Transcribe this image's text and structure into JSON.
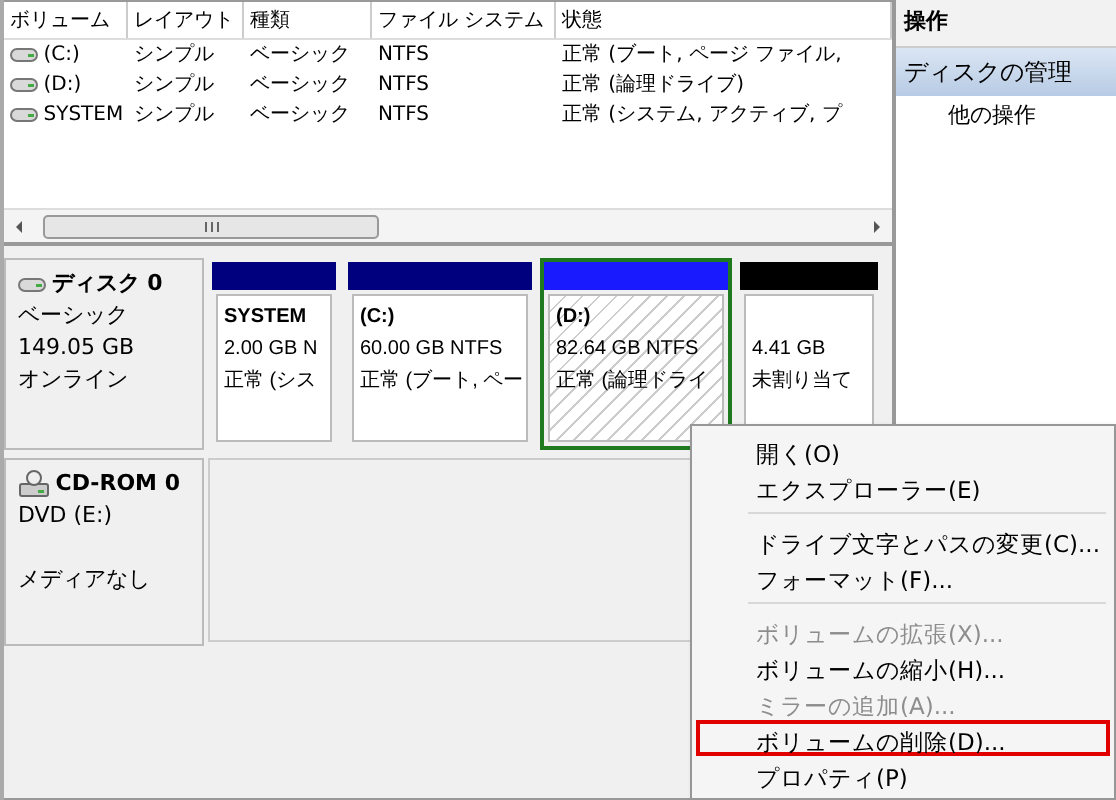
{
  "volume_list": {
    "columns": [
      "ボリューム",
      "レイアウト",
      "種類",
      "ファイル システム",
      "状態"
    ],
    "rows": [
      {
        "cells": [
          "(C:)",
          "シンプル",
          "ベーシック",
          "NTFS",
          "正常 (ブート, ページ ファイル,"
        ]
      },
      {
        "cells": [
          "(D:)",
          "シンプル",
          "ベーシック",
          "NTFS",
          "正常 (論理ドライブ)"
        ]
      },
      {
        "cells": [
          "SYSTEM",
          "シンプル",
          "ベーシック",
          "NTFS",
          "正常 (システム, アクティブ, プ"
        ]
      }
    ]
  },
  "disks": [
    {
      "kind": "disk",
      "name": "ディスク 0",
      "lines": [
        "ベーシック",
        "149.05 GB",
        "オンライン"
      ],
      "partitions": [
        {
          "kind": "primary",
          "name": "SYSTEM",
          "size": "2.00 GB N",
          "status": "正常 (シス",
          "selected": false
        },
        {
          "kind": "primary",
          "name": "(C:)",
          "size": "60.00 GB NTFS",
          "status": "正常 (ブート, ペー",
          "selected": false
        },
        {
          "kind": "logical",
          "name": "(D:)",
          "size": "82.64 GB NTFS",
          "status": "正常 (論理ドライ",
          "selected": true
        },
        {
          "kind": "unallocated",
          "size": "4.41 GB",
          "status": "未割り当て",
          "selected": false
        }
      ]
    },
    {
      "kind": "cdrom",
      "name": "CD-ROM 0",
      "lines": [
        "DVD (E:)",
        "メディアなし"
      ]
    }
  ],
  "actions": {
    "title": "操作",
    "items": [
      {
        "label": "ディスクの管理",
        "selected": true,
        "children": [
          {
            "label": "他の操作",
            "selected": false
          }
        ]
      }
    ]
  },
  "context_menu": {
    "groups": [
      [
        {
          "label": "開く(O)",
          "disabled": false,
          "highlighted": false
        },
        {
          "label": "エクスプローラー(E)",
          "disabled": false,
          "highlighted": false
        }
      ],
      [
        {
          "label": "ドライブ文字とパスの変更(C)...",
          "disabled": false,
          "highlighted": false
        },
        {
          "label": "フォーマット(F)...",
          "disabled": false,
          "highlighted": false
        }
      ],
      [
        {
          "label": "ボリュームの拡張(X)...",
          "disabled": true,
          "highlighted": false
        },
        {
          "label": "ボリュームの縮小(H)...",
          "disabled": false,
          "highlighted": false
        },
        {
          "label": "ミラーの追加(A)...",
          "disabled": true,
          "highlighted": false
        },
        {
          "label": "ボリュームの削除(D)...",
          "disabled": false,
          "highlighted": true
        },
        {
          "label": "プロパティ(P)",
          "disabled": false,
          "highlighted": false
        }
      ]
    ]
  }
}
